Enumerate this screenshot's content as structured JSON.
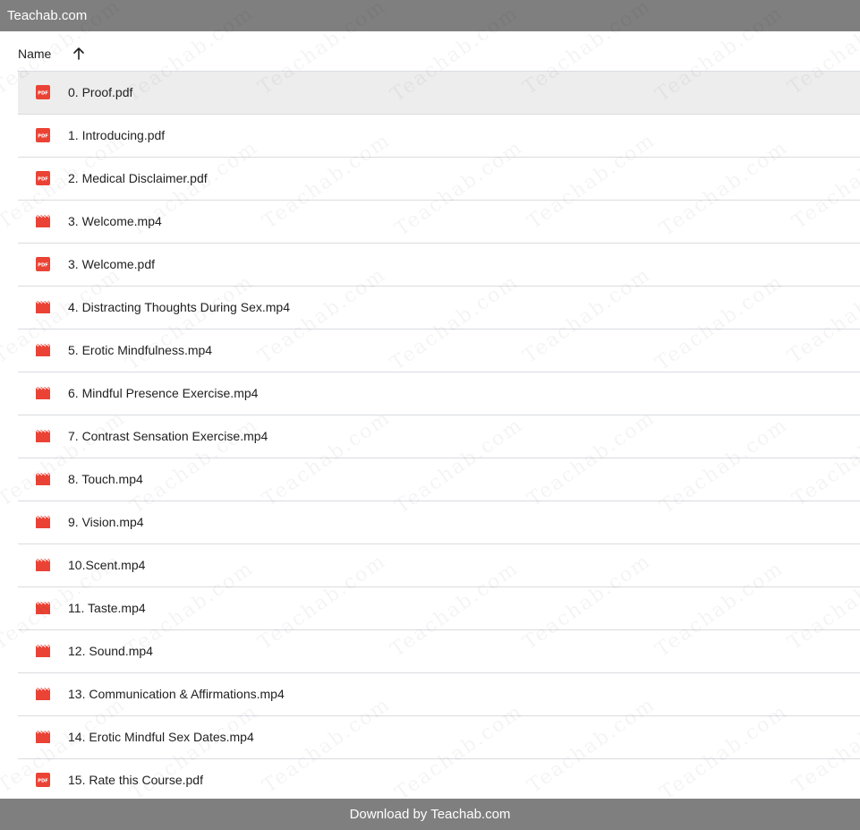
{
  "app": {
    "title": "Teachab.com"
  },
  "header": {
    "name_label": "Name",
    "sort_icon": "arrow-up-icon"
  },
  "files": [
    {
      "name": "0. Proof.pdf",
      "type": "pdf",
      "selected": true
    },
    {
      "name": "1. Introducing.pdf",
      "type": "pdf",
      "selected": false
    },
    {
      "name": "2. Medical Disclaimer.pdf",
      "type": "pdf",
      "selected": false
    },
    {
      "name": "3. Welcome.mp4",
      "type": "video",
      "selected": false
    },
    {
      "name": "3. Welcome.pdf",
      "type": "pdf",
      "selected": false
    },
    {
      "name": "4. Distracting Thoughts During Sex.mp4",
      "type": "video",
      "selected": false
    },
    {
      "name": "5. Erotic Mindfulness.mp4",
      "type": "video",
      "selected": false
    },
    {
      "name": "6. Mindful Presence Exercise.mp4",
      "type": "video",
      "selected": false
    },
    {
      "name": "7. Contrast Sensation Exercise.mp4",
      "type": "video",
      "selected": false
    },
    {
      "name": "8. Touch.mp4",
      "type": "video",
      "selected": false
    },
    {
      "name": "9. Vision.mp4",
      "type": "video",
      "selected": false
    },
    {
      "name": "10.Scent.mp4",
      "type": "video",
      "selected": false
    },
    {
      "name": "11. Taste.mp4",
      "type": "video",
      "selected": false
    },
    {
      "name": "12. Sound.mp4",
      "type": "video",
      "selected": false
    },
    {
      "name": "13. Communication & Affirmations.mp4",
      "type": "video",
      "selected": false
    },
    {
      "name": "14. Erotic Mindful Sex Dates.mp4",
      "type": "video",
      "selected": false
    },
    {
      "name": "15. Rate this Course.pdf",
      "type": "pdf",
      "selected": false
    }
  ],
  "watermark": {
    "text": "Teachab.com"
  },
  "footer": {
    "label": "Download by Teachab.com"
  },
  "colors": {
    "bar": "#7f7f7f",
    "icon_red": "#ea4335",
    "selected_row": "#ededed",
    "divider": "#dadce0"
  }
}
